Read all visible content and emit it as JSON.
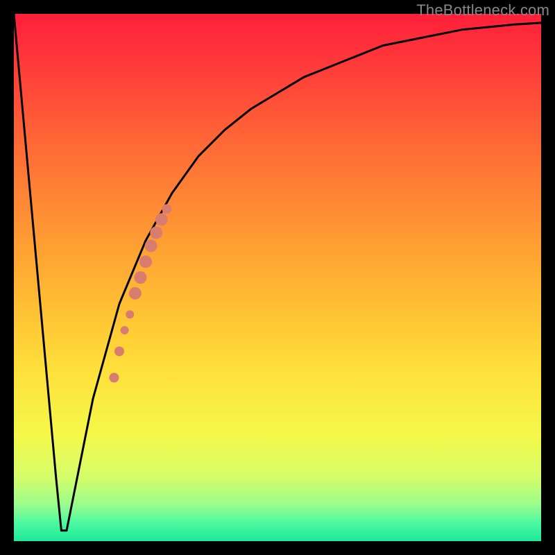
{
  "watermark": "TheBottleneck.com",
  "chart_data": {
    "type": "line",
    "title": "",
    "xlabel": "",
    "ylabel": "",
    "xlim": [
      0,
      100
    ],
    "ylim": [
      0,
      100
    ],
    "series": [
      {
        "name": "curve",
        "x": [
          0,
          2,
          4,
          6,
          8,
          9,
          10,
          12,
          15,
          20,
          25,
          30,
          35,
          40,
          45,
          50,
          55,
          60,
          65,
          70,
          75,
          80,
          85,
          90,
          95,
          100
        ],
        "y": [
          100,
          78,
          56,
          34,
          12,
          2,
          2,
          12,
          27,
          45,
          57,
          66,
          73,
          78,
          82,
          85,
          88,
          90,
          92,
          94,
          95,
          96,
          97,
          97.5,
          98,
          98.3
        ]
      }
    ],
    "highlighted_points": [
      {
        "x": 19,
        "y": 31,
        "r": 7
      },
      {
        "x": 20,
        "y": 36,
        "r": 7
      },
      {
        "x": 21,
        "y": 40,
        "r": 6
      },
      {
        "x": 22,
        "y": 43,
        "r": 6
      },
      {
        "x": 23,
        "y": 47,
        "r": 9
      },
      {
        "x": 24,
        "y": 50,
        "r": 9
      },
      {
        "x": 25,
        "y": 53,
        "r": 9
      },
      {
        "x": 26,
        "y": 56,
        "r": 9
      },
      {
        "x": 27,
        "y": 58.5,
        "r": 9
      },
      {
        "x": 28,
        "y": 61,
        "r": 9
      },
      {
        "x": 29,
        "y": 63,
        "r": 7
      }
    ],
    "gradient_stops": [
      {
        "offset": 0.0,
        "color": "#ff1f3a"
      },
      {
        "offset": 0.1,
        "color": "#ff3b3a"
      },
      {
        "offset": 0.25,
        "color": "#ff6a36"
      },
      {
        "offset": 0.4,
        "color": "#ff9433"
      },
      {
        "offset": 0.55,
        "color": "#ffbe33"
      },
      {
        "offset": 0.68,
        "color": "#ffe13a"
      },
      {
        "offset": 0.8,
        "color": "#f4f84a"
      },
      {
        "offset": 0.88,
        "color": "#d4fd6a"
      },
      {
        "offset": 0.93,
        "color": "#9bfd8c"
      },
      {
        "offset": 0.965,
        "color": "#4cf9a0"
      },
      {
        "offset": 1.0,
        "color": "#1de99a"
      }
    ],
    "highlight_color": "#d87c70",
    "curve_color": "#000000"
  }
}
